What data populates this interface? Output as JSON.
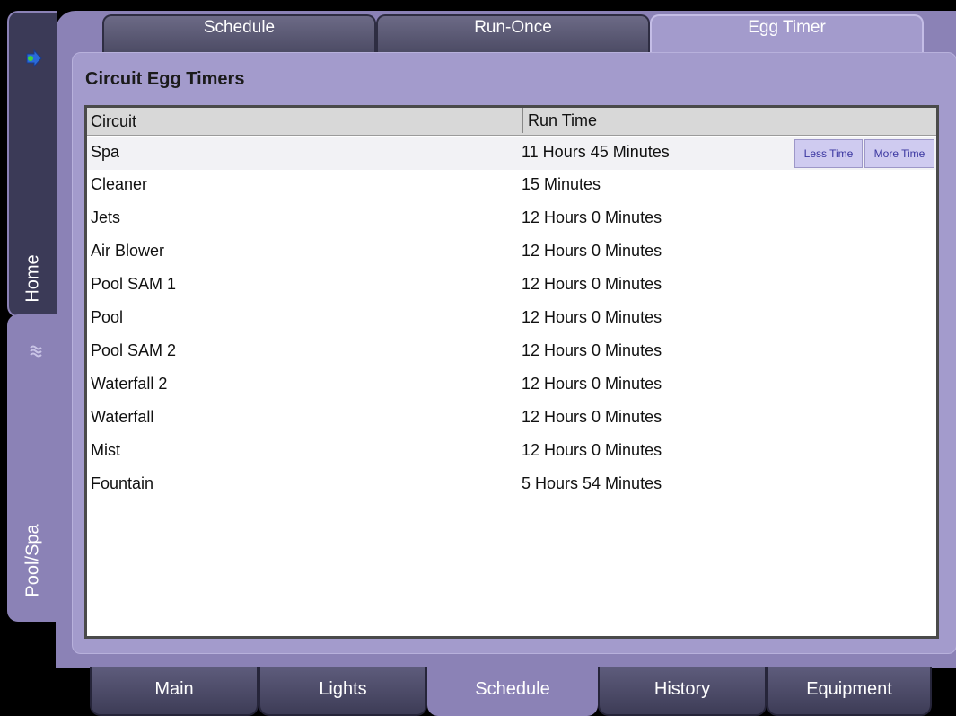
{
  "top_tabs": [
    {
      "label": "Schedule"
    },
    {
      "label": "Run-Once"
    },
    {
      "label": "Egg Timer",
      "active": true
    }
  ],
  "side_tabs": [
    {
      "label": "Home",
      "icon": "arrow-icon"
    },
    {
      "label": "Pool/Spa",
      "icon": "pool-icon",
      "active": true
    }
  ],
  "panel": {
    "title": "Circuit Egg Timers"
  },
  "table": {
    "columns": [
      "Circuit",
      "Run Time"
    ],
    "rows": [
      {
        "circuit": "Spa",
        "run_time": "11 Hours 45 Minutes"
      },
      {
        "circuit": "Cleaner",
        "run_time": "15 Minutes"
      },
      {
        "circuit": "Jets",
        "run_time": "12 Hours 0 Minutes"
      },
      {
        "circuit": "Air Blower",
        "run_time": "12 Hours 0 Minutes"
      },
      {
        "circuit": "Pool SAM 1",
        "run_time": "12 Hours 0 Minutes"
      },
      {
        "circuit": "Pool",
        "run_time": "12 Hours 0 Minutes"
      },
      {
        "circuit": "Pool SAM 2",
        "run_time": "12 Hours 0 Minutes"
      },
      {
        "circuit": "Waterfall 2",
        "run_time": "12 Hours 0 Minutes"
      },
      {
        "circuit": "Waterfall",
        "run_time": "12 Hours 0 Minutes"
      },
      {
        "circuit": "Mist",
        "run_time": "12 Hours 0 Minutes"
      },
      {
        "circuit": "Fountain",
        "run_time": "5 Hours 54 Minutes"
      }
    ],
    "selected_row": 0,
    "less_time_label": "Less Time",
    "more_time_label": "More Time"
  },
  "bottom_tabs": [
    {
      "label": "Main"
    },
    {
      "label": "Lights"
    },
    {
      "label": "Schedule",
      "active": true
    },
    {
      "label": "History"
    },
    {
      "label": "Equipment"
    }
  ],
  "colors": {
    "frame": "#8b82b6",
    "panel": "#a39bcc",
    "accent": "#3a36a0"
  }
}
